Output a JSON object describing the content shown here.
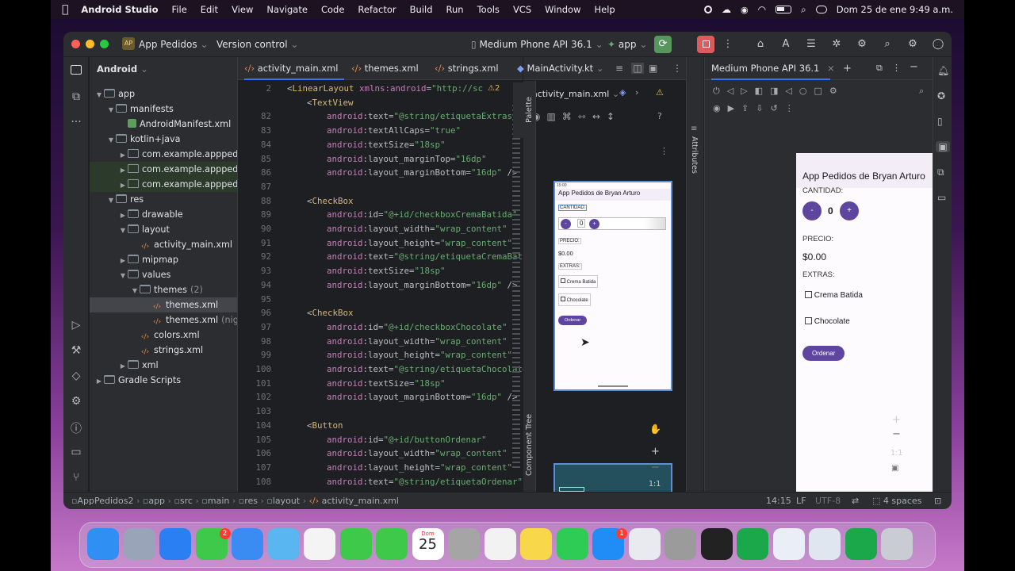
{
  "menubar": {
    "app": "Android Studio",
    "items": [
      "File",
      "Edit",
      "View",
      "Navigate",
      "Code",
      "Refactor",
      "Build",
      "Run",
      "Tools",
      "VCS",
      "Window",
      "Help"
    ],
    "datetime": "Dom 25 de ene  9:49 a.m."
  },
  "titlebar": {
    "project_badge": "AP",
    "project": "App Pedidos",
    "vcs": "Version control",
    "device": "Medium Phone API 36.1",
    "run_config": "app"
  },
  "project_panel": {
    "title": "Android",
    "tree": [
      {
        "label": "app",
        "depth": 0,
        "icon": "module",
        "open": true
      },
      {
        "label": "manifests",
        "depth": 1,
        "icon": "folder",
        "open": true
      },
      {
        "label": "AndroidManifest.xml",
        "depth": 2,
        "icon": "manifest"
      },
      {
        "label": "kotlin+java",
        "depth": 1,
        "icon": "folder",
        "open": true
      },
      {
        "label": "com.example.apppedid",
        "depth": 2,
        "icon": "package",
        "collapsed": true
      },
      {
        "label": "com.example.apppedid",
        "depth": 2,
        "icon": "package",
        "collapsed": true
      },
      {
        "label": "com.example.apppedid",
        "depth": 2,
        "icon": "package",
        "collapsed": true
      },
      {
        "label": "res",
        "depth": 1,
        "icon": "folder",
        "open": true
      },
      {
        "label": "drawable",
        "depth": 2,
        "icon": "folder",
        "collapsed": true
      },
      {
        "label": "layout",
        "depth": 2,
        "icon": "folder",
        "open": true
      },
      {
        "label": "activity_main.xml",
        "depth": 3,
        "icon": "xml"
      },
      {
        "label": "mipmap",
        "depth": 2,
        "icon": "folder",
        "collapsed": true
      },
      {
        "label": "values",
        "depth": 2,
        "icon": "folder",
        "open": true
      },
      {
        "label": "themes",
        "depth": 3,
        "icon": "folder",
        "open": true,
        "suffix": "(2)"
      },
      {
        "label": "themes.xml",
        "depth": 4,
        "icon": "xml",
        "selected": true
      },
      {
        "label": "themes.xml",
        "depth": 4,
        "icon": "xml",
        "suffix": "(nigh"
      },
      {
        "label": "colors.xml",
        "depth": 3,
        "icon": "xml"
      },
      {
        "label": "strings.xml",
        "depth": 3,
        "icon": "xml"
      },
      {
        "label": "xml",
        "depth": 2,
        "icon": "folder",
        "collapsed": true
      },
      {
        "label": "Gradle Scripts",
        "depth": 0,
        "icon": "gradle",
        "collapsed": true
      }
    ]
  },
  "editor": {
    "tabs": [
      "activity_main.xml",
      "themes.xml",
      "strings.xml",
      "MainActivity.kt"
    ],
    "warning_count": "2",
    "lines": [
      {
        "n": "2",
        "tokens": [
          [
            "n",
            "<"
          ],
          [
            "t",
            "LinearLayout "
          ],
          [
            "a",
            "xmlns:"
          ],
          [
            "a",
            "android"
          ],
          [
            "n",
            "="
          ],
          [
            "s",
            "\"http://sc"
          ]
        ],
        "indent": 0
      },
      {
        "n": "",
        "tokens": [
          [
            "n",
            "<"
          ],
          [
            "t",
            "TextView"
          ]
        ],
        "indent": 1
      },
      {
        "n": "82",
        "tokens": [
          [
            "a",
            "android"
          ],
          [
            "n",
            ":text="
          ],
          [
            "s",
            "\"@string/etiquetaExtras\""
          ]
        ],
        "indent": 2
      },
      {
        "n": "83",
        "tokens": [
          [
            "a",
            "android"
          ],
          [
            "n",
            ":textAllCaps="
          ],
          [
            "s",
            "\"true\""
          ]
        ],
        "indent": 2
      },
      {
        "n": "84",
        "tokens": [
          [
            "a",
            "android"
          ],
          [
            "n",
            ":textSize="
          ],
          [
            "s",
            "\"18sp\""
          ]
        ],
        "indent": 2
      },
      {
        "n": "85",
        "tokens": [
          [
            "a",
            "android"
          ],
          [
            "n",
            ":layout_marginTop="
          ],
          [
            "s",
            "\"16dp\""
          ]
        ],
        "indent": 2
      },
      {
        "n": "86",
        "tokens": [
          [
            "a",
            "android"
          ],
          [
            "n",
            ":layout_marginBottom="
          ],
          [
            "s",
            "\"16dp\""
          ],
          [
            "n",
            " />"
          ]
        ],
        "indent": 2
      },
      {
        "n": "87",
        "tokens": [],
        "indent": 0
      },
      {
        "n": "88",
        "tokens": [
          [
            "n",
            "<"
          ],
          [
            "t",
            "CheckBox"
          ]
        ],
        "indent": 1
      },
      {
        "n": "89",
        "tokens": [
          [
            "a",
            "android"
          ],
          [
            "n",
            ":id="
          ],
          [
            "s",
            "\"@+id/checkboxCremaBatida\""
          ]
        ],
        "indent": 2
      },
      {
        "n": "90",
        "tokens": [
          [
            "a",
            "android"
          ],
          [
            "n",
            ":layout_width="
          ],
          [
            "s",
            "\"wrap_content\""
          ]
        ],
        "indent": 2
      },
      {
        "n": "91",
        "tokens": [
          [
            "a",
            "android"
          ],
          [
            "n",
            ":layout_height="
          ],
          [
            "s",
            "\"wrap_content\""
          ]
        ],
        "indent": 2
      },
      {
        "n": "92",
        "tokens": [
          [
            "a",
            "android"
          ],
          [
            "n",
            ":text="
          ],
          [
            "s",
            "\"@string/etiquetaCremaBatid"
          ]
        ],
        "indent": 2
      },
      {
        "n": "93",
        "tokens": [
          [
            "a",
            "android"
          ],
          [
            "n",
            ":textSize="
          ],
          [
            "s",
            "\"18sp\""
          ]
        ],
        "indent": 2
      },
      {
        "n": "94",
        "tokens": [
          [
            "a",
            "android"
          ],
          [
            "n",
            ":layout_marginBottom="
          ],
          [
            "s",
            "\"16dp\""
          ],
          [
            "n",
            " />"
          ]
        ],
        "indent": 2
      },
      {
        "n": "95",
        "tokens": [],
        "indent": 0
      },
      {
        "n": "96",
        "tokens": [
          [
            "n",
            "<"
          ],
          [
            "t",
            "CheckBox"
          ]
        ],
        "indent": 1
      },
      {
        "n": "97",
        "tokens": [
          [
            "a",
            "android"
          ],
          [
            "n",
            ":id="
          ],
          [
            "s",
            "\"@+id/checkboxChocolate\""
          ]
        ],
        "indent": 2
      },
      {
        "n": "98",
        "tokens": [
          [
            "a",
            "android"
          ],
          [
            "n",
            ":layout_width="
          ],
          [
            "s",
            "\"wrap_content\""
          ]
        ],
        "indent": 2
      },
      {
        "n": "99",
        "tokens": [
          [
            "a",
            "android"
          ],
          [
            "n",
            ":layout_height="
          ],
          [
            "s",
            "\"wrap_content\""
          ]
        ],
        "indent": 2
      },
      {
        "n": "100",
        "tokens": [
          [
            "a",
            "android"
          ],
          [
            "n",
            ":text="
          ],
          [
            "s",
            "\"@string/etiquetaChocolate"
          ]
        ],
        "indent": 2
      },
      {
        "n": "101",
        "tokens": [
          [
            "a",
            "android"
          ],
          [
            "n",
            ":textSize="
          ],
          [
            "s",
            "\"18sp\""
          ]
        ],
        "indent": 2
      },
      {
        "n": "102",
        "tokens": [
          [
            "a",
            "android"
          ],
          [
            "n",
            ":layout_marginBottom="
          ],
          [
            "s",
            "\"16dp\""
          ],
          [
            "n",
            " />"
          ]
        ],
        "indent": 2
      },
      {
        "n": "103",
        "tokens": [],
        "indent": 0
      },
      {
        "n": "104",
        "tokens": [
          [
            "n",
            "<"
          ],
          [
            "t",
            "Button"
          ]
        ],
        "indent": 1
      },
      {
        "n": "105",
        "tokens": [
          [
            "a",
            "android"
          ],
          [
            "n",
            ":id="
          ],
          [
            "s",
            "\"@+id/buttonOrdenar\""
          ]
        ],
        "indent": 2
      },
      {
        "n": "106",
        "tokens": [
          [
            "a",
            "android"
          ],
          [
            "n",
            ":layout_width="
          ],
          [
            "s",
            "\"wrap_content\""
          ]
        ],
        "indent": 2
      },
      {
        "n": "107",
        "tokens": [
          [
            "a",
            "android"
          ],
          [
            "n",
            ":layout_height="
          ],
          [
            "s",
            "\"wrap_content\""
          ]
        ],
        "indent": 2
      },
      {
        "n": "108",
        "tokens": [
          [
            "a",
            "android"
          ],
          [
            "n",
            ":text="
          ],
          [
            "s",
            "\"@string/etiquetaOrdenar\""
          ]
        ],
        "indent": 2
      }
    ]
  },
  "design": {
    "file": "activity_main.xml",
    "palette": "Palette",
    "attributes": "Attributes",
    "component_tree": "Component Tree",
    "zoom": "1:1",
    "preview": {
      "time": "15:00",
      "title": "App Pedidos de Bryan Arturo",
      "cantidad": "CANTIDAD:",
      "minus": "-",
      "qty": "0",
      "plus": "+",
      "precio": "PRECIO:",
      "price": "$0.00",
      "extras": "EXTRAS:",
      "crema": "Crema Batida",
      "choco": "Chocolate",
      "ordenar": "Ordenar"
    }
  },
  "running_devices": {
    "tab": "Medium Phone API 36.1",
    "zoom": "1:1",
    "app": {
      "title": "App Pedidos de Bryan Arturo",
      "cantidad": "CANTIDAD:",
      "minus": "-",
      "qty": "0",
      "plus": "+",
      "precio": "PRECIO:",
      "price": "$0.00",
      "extras": "EXTRAS:",
      "crema": "Crema Batida",
      "choco": "Chocolate",
      "ordenar": "Ordenar"
    }
  },
  "statusbar": {
    "crumbs": [
      "AppPedidos2",
      "app",
      "src",
      "main",
      "res",
      "layout",
      "activity_main.xml"
    ],
    "position": "14:15",
    "line_sep": "LF",
    "encoding": "UTF-8",
    "indent": "4 spaces"
  },
  "dock": {
    "apps": [
      "finder-icon",
      "launchpad-icon",
      "safari-icon",
      "messages-icon",
      "mail-icon",
      "maps-icon",
      "photos-icon",
      "facetime-icon",
      "phone-icon",
      "calendar-icon",
      "contacts-icon",
      "reminders-icon",
      "notes-icon",
      "whatsapp-icon",
      "app-store-icon",
      "iphone-mirroring-icon",
      "system-settings-icon",
      "terminal-icon",
      "numbers-icon",
      "android-studio-icon",
      "quicktime-icon",
      "sheets-icon",
      "trash-icon"
    ],
    "calendar_month": "Dom",
    "calendar_day": "25",
    "messages_badge": "2",
    "appstore_badge": "1"
  },
  "colors": {
    "accent": "#3574f0",
    "phone_purple": "#5e46a0",
    "ide_bg": "#1e1f22",
    "panel_bg": "#2b2d30"
  }
}
